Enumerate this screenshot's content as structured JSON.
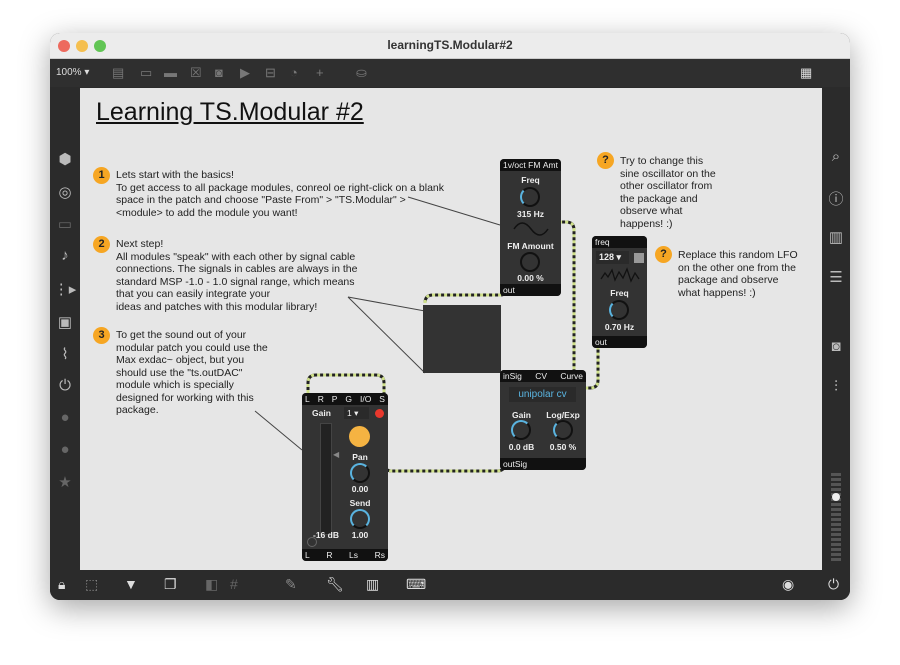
{
  "window": {
    "title": "learningTS.Modular#2"
  },
  "toolbar": {
    "zoom": "100%"
  },
  "patch": {
    "heading": "Learning TS.Modular #2",
    "steps": [
      {
        "num": "1",
        "lines": [
          "Lets start with the basics!",
          "To get access to all package modules, conreol oe right-click on a blank",
          "space in the patch and choose \"Paste From\" > \"TS.Modular\" >",
          "<module> to add the module you want!"
        ]
      },
      {
        "num": "2",
        "lines": [
          "Next step!",
          "All modules \"speak\" with each other by signal cable",
          "connections. The signals in cables are always in the",
          "standard MSP -1.0 - 1.0 signal range, which means",
          "that  you can easily integrate your",
          "ideas and patches with this modular library!"
        ]
      },
      {
        "num": "3",
        "lines": [
          "To get the sound out of your",
          "modular patch you could use the",
          "Max exdac~ object, but you",
          "should use the \"ts.outDAC\"",
          "module which is specially",
          "designed for working with this",
          "package."
        ]
      }
    ],
    "hints": [
      {
        "icon": "?",
        "lines": [
          "Try to change this",
          "sine oscillator on the",
          "other oscillator from",
          "the  package and",
          "observe what",
          "happens! :)"
        ]
      },
      {
        "icon": "?",
        "lines": [
          "Replace this random LFO",
          "on the other one from the",
          "package and observe",
          "what happens! :)"
        ]
      }
    ],
    "osc": {
      "inlets": [
        "1v/oct",
        "FM",
        "Amt"
      ],
      "freq_label": "Freq",
      "freq_value": "315 Hz",
      "fm_label": "FM Amount",
      "fm_value": "0.00 %",
      "outlet": "out"
    },
    "lfo": {
      "inlet": "freq",
      "menu": "128",
      "freq_label": "Freq",
      "freq_value": "0.70 Hz",
      "outlet": "out"
    },
    "vca": {
      "inlets": [
        "inSig",
        "CV",
        "Curve"
      ],
      "mode": "unipolar cv",
      "gain_label": "Gain",
      "gain_value": "0.0 dB",
      "curve_label": "Log/Exp",
      "curve_value": "0.50 %",
      "outlet": "outSig"
    },
    "dac": {
      "inlets": [
        "L",
        "R",
        "P",
        "G",
        "I/O",
        "S"
      ],
      "gain_label": "Gain",
      "channel": "1",
      "pan_label": "Pan",
      "pan_value": "0.00",
      "send_label": "Send",
      "send_value": "1.00",
      "meter_value": "-16 dB",
      "outlets": [
        "L",
        "R",
        "Ls",
        "Rs"
      ]
    }
  }
}
